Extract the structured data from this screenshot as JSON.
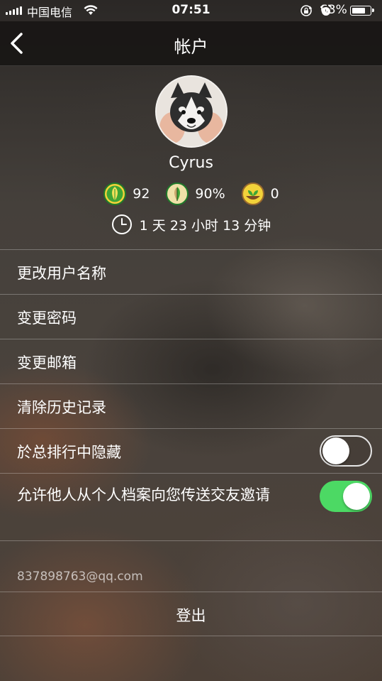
{
  "status_bar": {
    "carrier": "中国电信",
    "time": "07:51",
    "battery": "63%"
  },
  "nav": {
    "title": "帐户"
  },
  "profile": {
    "username": "Cyrus",
    "stats": [
      {
        "icon": "green-leaf-icon",
        "value": "92"
      },
      {
        "icon": "half-leaf-icon",
        "value": "90%"
      },
      {
        "icon": "sprout-icon",
        "value": "0"
      }
    ],
    "duration": "1 天 23 小时 13 分钟"
  },
  "menu": {
    "items": [
      {
        "label": "更改用户名称"
      },
      {
        "label": "变更密码"
      },
      {
        "label": "变更邮箱"
      },
      {
        "label": "清除历史记录"
      },
      {
        "label": "於总排行中隐藏",
        "toggle": false
      },
      {
        "label": "允许他人从个人档案向您传送交友邀请",
        "toggle": true
      }
    ]
  },
  "account": {
    "email": "837898763@qq.com",
    "logout_label": "登出"
  },
  "colors": {
    "toggle_on": "#4cd964",
    "leaf_green": "#3fa535",
    "leaf_ring": "#f2d23a"
  }
}
